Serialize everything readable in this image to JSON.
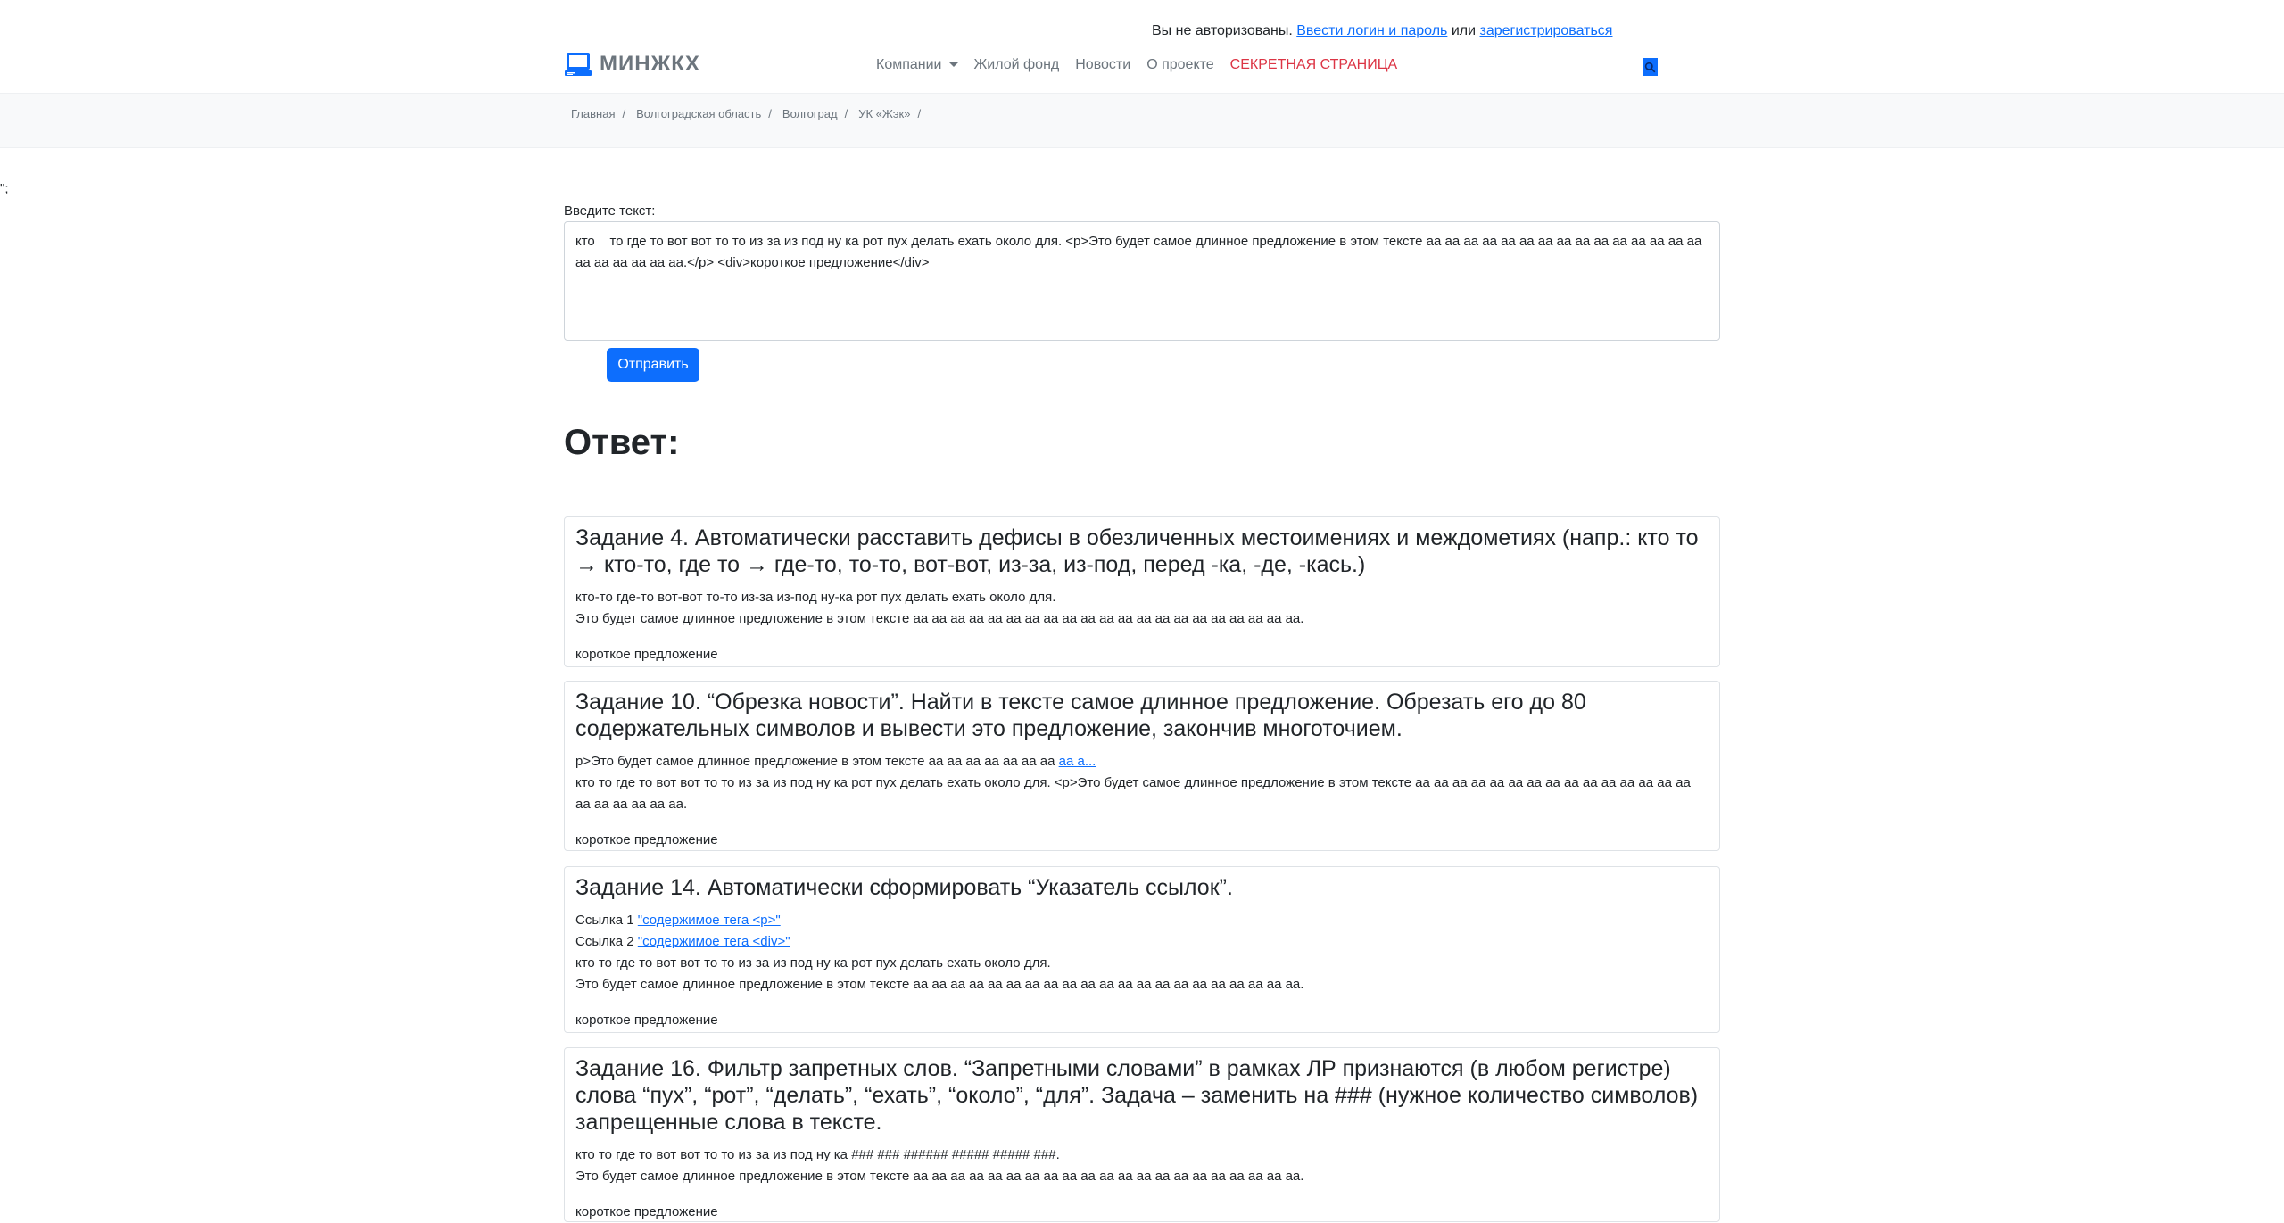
{
  "stray_text": "\";",
  "auth": {
    "prefix": "Вы не авторизованы.",
    "login_link": "Ввести логин и пароль",
    "or": "или",
    "register_link": "зарегистрироваться"
  },
  "brand": {
    "name": "МИНЖКХ",
    "icon": "laptop-icon"
  },
  "nav": {
    "companies": "Компании",
    "housing": "Жилой фонд",
    "news": "Новости",
    "about": "О проекте",
    "secret": "СЕКРЕТНАЯ СТРАНИЦА",
    "search_icon": "search-icon"
  },
  "breadcrumb": [
    "Главная",
    "Волгоградская область",
    "Волгоград",
    "УК «Жэк»"
  ],
  "form": {
    "label": "Введите текст:",
    "value": "кто    то где то вот вот то то из за из под ну ка рот пух делать ехать около для. <p>Это будет самое длинное предложение в этом тексте аа аа аа аа аа аа аа аа аа аа аа аа аа аа аа аа аа аа аа аа аа.</p> <div>короткое предложение</div>",
    "submit": "Отправить"
  },
  "answer_title": "Ответ:",
  "tasks": {
    "t4": {
      "title": "Задание 4. Автоматически расставить дефисы в обезличенных местоимениях и междометиях (напр.: кто то → кто-то, где то → где-то, то-то, вот-вот, из-за, из-под, перед -ка, -де, -кась.)",
      "line1": "кто-то где-то вот-вот то-то из-за из-под ну-ка рот пух делать ехать около для.",
      "line2": "Это будет самое длинное предложение в этом тексте аа аа аа аа аа аа аа аа аа аа аа аа аа аа аа аа аа аа аа аа аа.",
      "line3": "короткое предложение"
    },
    "t10": {
      "title": "Задание 10. “Обрезка новости”. Найти в тексте самое длинное предложение. Обрезать его до 80 содержательных символов и вывести это предложение, закончив многоточием.",
      "line1": "p>Это будет самое длинное предложение в этом тексте аа аа аа аа аа аа аа",
      "line1_link": "аа а...",
      "line2": "кто то где то вот вот то то из за из под ну ка рот пух делать ехать около для. <p>Это будет самое длинное предложение в этом тексте аа аа аа аа аа аа аа аа аа аа аа аа аа аа аа аа аа аа аа аа аа.",
      "line3": "короткое предложение"
    },
    "t14": {
      "title": "Задание 14. Автоматически сформировать “Указатель ссылок”.",
      "ref1_label": "Ссылка 1",
      "ref1_link": "\"содержимое тега <p>\"",
      "ref2_label": "Ссылка 2",
      "ref2_link": "\"содержимое тега <div>\"",
      "line1": "кто то где то вот вот то то из за из под ну ка рот пух делать ехать около для.",
      "line2": "Это будет самое длинное предложение в этом тексте аа аа аа аа аа аа аа аа аа аа аа аа аа аа аа аа аа аа аа аа аа.",
      "line3": "короткое предложение"
    },
    "t16": {
      "title": "Задание 16. Фильтр запретных слов. “Запретными словами” в рамках ЛР признаются (в любом регистре) слова “пух”, “рот”, “делать”, “ехать”, “около”, “для”. Задача – заменить на ### (нужное количество символов) запрещенные слова в тексте.",
      "line1": "кто то где то вот вот то то из за из под ну ка ### ### ###### ##### ##### ###.",
      "line2": "Это будет самое длинное предложение в этом тексте аа аа аа аа аа аа аа аа аа аа аа аа аа аа аа аа аа аа аа аа аа.",
      "line3": "короткое предложение"
    }
  },
  "colors": {
    "primary": "#0d6efd",
    "secret": "#dc3545",
    "muted": "#6c757d"
  }
}
